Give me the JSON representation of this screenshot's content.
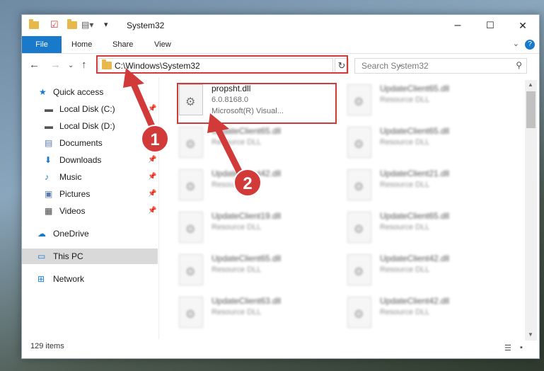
{
  "window": {
    "title": "System32",
    "minimize": "–",
    "maximize": "☐",
    "close": "✕"
  },
  "ribbon": {
    "file": "File",
    "home": "Home",
    "share": "Share",
    "view": "View",
    "help": "?"
  },
  "nav": {
    "address": "C:\\Windows\\System32",
    "search_placeholder": "Search System32"
  },
  "sidebar": {
    "items": [
      {
        "label": "Quick access",
        "icon": "star-icon"
      },
      {
        "label": "Local Disk (C:)",
        "icon": "drive-icon",
        "pinned": true
      },
      {
        "label": "Local Disk (D:)",
        "icon": "drive-icon"
      },
      {
        "label": "Documents",
        "icon": "documents-icon",
        "pinned": true
      },
      {
        "label": "Downloads",
        "icon": "download-icon",
        "pinned": true
      },
      {
        "label": "Music",
        "icon": "music-icon",
        "pinned": true
      },
      {
        "label": "Pictures",
        "icon": "pictures-icon",
        "pinned": true
      },
      {
        "label": "Videos",
        "icon": "videos-icon",
        "pinned": true
      },
      {
        "label": "OneDrive",
        "icon": "cloud-icon"
      },
      {
        "label": "This PC",
        "icon": "computer-icon",
        "selected": true
      },
      {
        "label": "Network",
        "icon": "network-icon"
      }
    ]
  },
  "files": [
    {
      "name": "propsht.dll",
      "version": "6.0.8168.0",
      "desc": "Microsoft(R) Visual..."
    },
    {
      "name": "UpdateClient65.dll",
      "desc": "Resource DLL"
    },
    {
      "name": "UpdateClient65.dll",
      "desc": "Resource DLL"
    },
    {
      "name": "UpdateClient65.dll",
      "desc": "Resource DLL"
    },
    {
      "name": "UpdateClient42.dll",
      "desc": "Resource DLL"
    },
    {
      "name": "UpdateClient21.dll",
      "desc": "Resource DLL"
    },
    {
      "name": "UpdateClient19.dll",
      "desc": "Resource DLL"
    },
    {
      "name": "UpdateClient65.dll",
      "desc": "Resource DLL"
    },
    {
      "name": "UpdateClient65.dll",
      "desc": "Resource DLL"
    },
    {
      "name": "UpdateClient42.dll",
      "desc": "Resource DLL"
    },
    {
      "name": "UpdateClient63.dll",
      "desc": "Resource DLL"
    },
    {
      "name": "UpdateClient42.dll",
      "desc": "Resource DLL"
    }
  ],
  "status": {
    "count": "129 items"
  },
  "callouts": {
    "one": "1",
    "two": "2"
  },
  "colors": {
    "accent": "#1979ca",
    "highlight": "#d23a3a",
    "folder": "#e8b94a"
  }
}
